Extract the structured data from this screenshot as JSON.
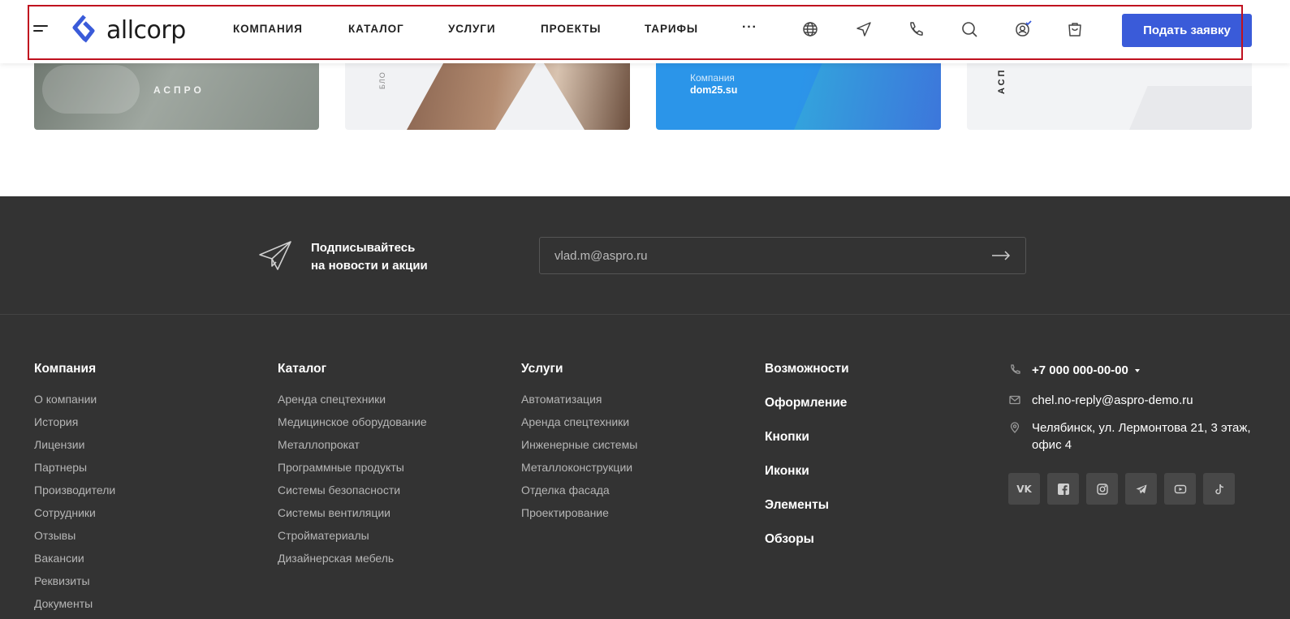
{
  "header": {
    "logo_text": "allcorp",
    "nav": [
      {
        "label": "КОМПАНИЯ"
      },
      {
        "label": "КАТАЛОГ"
      },
      {
        "label": "УСЛУГИ"
      },
      {
        "label": "ПРОЕКТЫ"
      },
      {
        "label": "ТАРИФЫ"
      },
      {
        "label": "···"
      }
    ],
    "icons": [
      "globe-icon",
      "send-icon",
      "phone-icon",
      "search-icon",
      "account-icon",
      "cart-icon"
    ],
    "cta_label": "Подать заявку",
    "accent": "#3a5bd9",
    "frame_color": "#c0111f"
  },
  "cards": {
    "card1_text": "АСПРО",
    "card2_text": "БЛО",
    "card3_small": "Компания",
    "card3_big": "dom25.su",
    "card4_text": "АСП"
  },
  "subscribe": {
    "line1": "Подписывайтесь",
    "line2": "на новости и акции",
    "email_value": "vlad.m@aspro.ru"
  },
  "footer": {
    "columns": [
      {
        "title": "Компания",
        "links": [
          "О компании",
          "История",
          "Лицензии",
          "Партнеры",
          "Производители",
          "Сотрудники",
          "Отзывы",
          "Вакансии",
          "Реквизиты",
          "Документы"
        ]
      },
      {
        "title": "Каталог",
        "links": [
          "Аренда спецтехники",
          "Медицинское оборудование",
          "Металлопрокат",
          "Программные продукты",
          "Системы безопасности",
          "Системы вентиляции",
          "Стройматериалы",
          "Дизайнерская мебель"
        ]
      },
      {
        "title": "Услуги",
        "links": [
          "Автоматизация",
          "Аренда спецтехники",
          "Инженерные системы",
          "Металлоконструкции",
          "Отделка фасада",
          "Проектирование"
        ]
      }
    ],
    "features": [
      "Возможности",
      "Оформление",
      "Кнопки",
      "Иконки",
      "Элементы",
      "Обзоры"
    ],
    "contacts": {
      "phone": "+7 000 000-00-00",
      "email": "chel.no-reply@aspro-demo.ru",
      "address": "Челябинск, ул. Лермонтова 21, 3 этаж, офис 4"
    },
    "socials": [
      "vk-icon",
      "facebook-icon",
      "instagram-icon",
      "telegram-icon",
      "youtube-icon",
      "tiktok-icon"
    ],
    "vk_label": "VK"
  }
}
